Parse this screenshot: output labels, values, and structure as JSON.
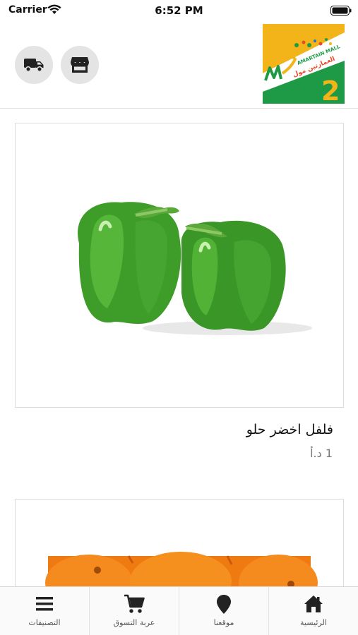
{
  "status_bar": {
    "carrier": "Carrier",
    "time": "6:52 PM"
  },
  "header": {
    "logo_text": "AMARTAIN MALL",
    "logo_number": "2",
    "buttons": [
      {
        "icon": "delivery-truck-icon"
      },
      {
        "icon": "store-icon"
      }
    ]
  },
  "products": [
    {
      "name": "فلفل اخضر حلو",
      "price": "1 د.أ",
      "image": "green-bell-peppers"
    },
    {
      "name": "",
      "price": "",
      "image": "oranges"
    }
  ],
  "tab_bar": {
    "tabs": [
      {
        "label": "الرئيسية",
        "icon": "home-icon"
      },
      {
        "label": "موقعنا",
        "icon": "location-pin-icon"
      },
      {
        "label": "عربة التسوق",
        "icon": "shopping-cart-icon"
      },
      {
        "label": "التصنيفات",
        "icon": "menu-icon"
      }
    ]
  },
  "colors": {
    "logo_yellow": "#f2b418",
    "logo_green": "#1e9a47",
    "pepper_green": "#3c9a2a",
    "orange": "#f07a12",
    "icon_dark": "#222222",
    "button_gray": "#e4e4e4"
  }
}
